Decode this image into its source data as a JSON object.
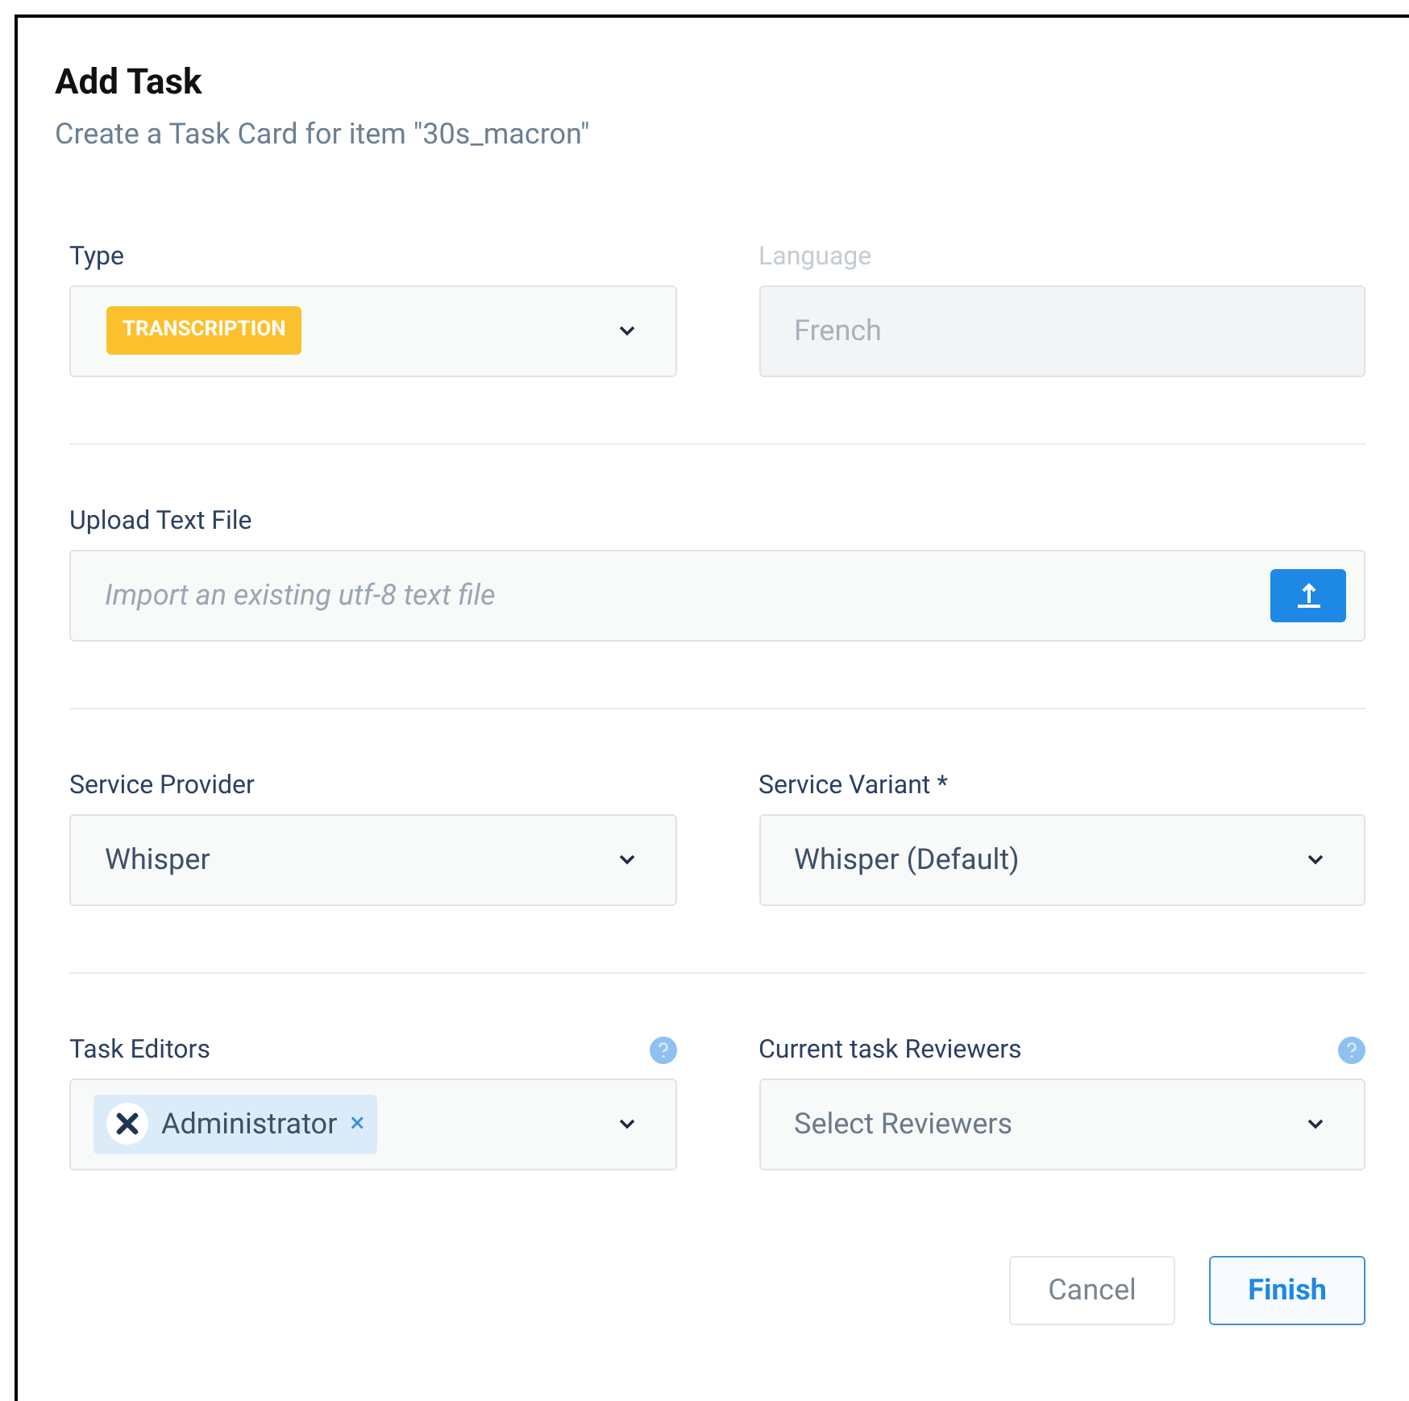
{
  "dialog": {
    "title": "Add Task",
    "subtitle": "Create a Task Card for item \"30s_macron\""
  },
  "sections": [
    {
      "fields": [
        {
          "kind": "tag-select",
          "label": "Type",
          "value": "TRANSCRIPTION"
        },
        {
          "kind": "input",
          "label": "Language",
          "value": "French",
          "disabled": true
        }
      ]
    },
    {
      "fields": [
        {
          "kind": "file",
          "label": "Upload Text File",
          "placeholder": "Import an existing utf-8 text file"
        }
      ]
    },
    {
      "fields": [
        {
          "kind": "select",
          "label": "Service Provider",
          "value": "Whisper"
        },
        {
          "kind": "select",
          "label": "Service Variant *",
          "value": "Whisper (Default)"
        }
      ]
    },
    {
      "fields": [
        {
          "kind": "chip-select",
          "label": "Task Editors",
          "chips": [
            {
              "label": "Administrator",
              "remove": "×"
            }
          ],
          "help": true
        },
        {
          "kind": "select",
          "label": "Current task Reviewers",
          "placeholder": "Select Reviewers",
          "help": true
        }
      ]
    }
  ],
  "buttons": [
    {
      "label": "Cancel",
      "primary": false
    },
    {
      "label": "Finish",
      "primary": true
    }
  ]
}
